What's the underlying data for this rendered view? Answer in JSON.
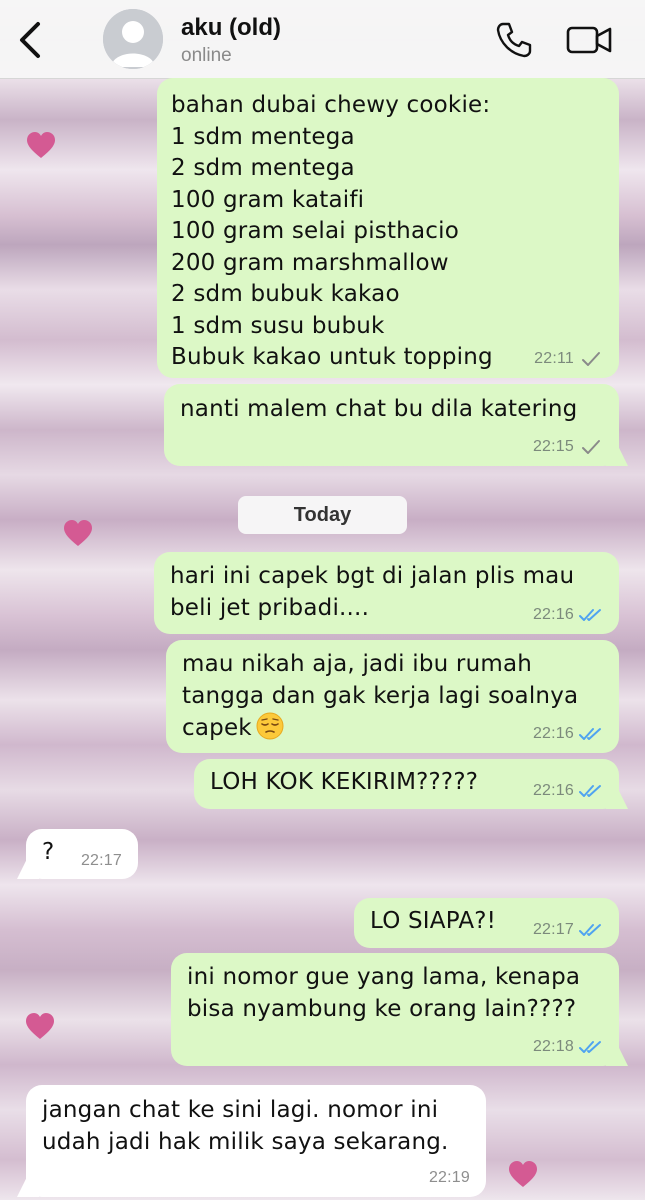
{
  "header": {
    "contact_name": "aku (old)",
    "status": "online"
  },
  "date_separator": "Today",
  "messages": [
    {
      "text": "bahan dubai chewy cookie:\n1 sdm mentega\n2 sdm mentega\n100 gram kataifi\n100 gram selai pisthacio\n200 gram marshmallow\n2 sdm bubuk kakao\n1 sdm susu bubuk\nBubuk kakao untuk topping",
      "time": "22:11",
      "status": "sent"
    },
    {
      "text": "nanti malem chat bu dila katering",
      "time": "22:15",
      "status": "sent"
    },
    {
      "text": "hari ini capek bgt di jalan plis mau\nbeli jet pribadi....",
      "time": "22:16",
      "status": "read"
    },
    {
      "text": "mau nikah aja, jadi ibu rumah\ntangga dan gak kerja lagi soalnya\ncapek",
      "time": "22:16",
      "status": "read",
      "emoji": "pensive-face"
    },
    {
      "text": "LOH KOK KEKIRIM?????",
      "time": "22:16",
      "status": "read"
    },
    {
      "text": "?",
      "time": "22:17",
      "direction": "incoming"
    },
    {
      "text": "LO SIAPA?!",
      "time": "22:17",
      "status": "read"
    },
    {
      "text": "ini nomor gue yang lama, kenapa\nbisa nyambung ke orang lain????",
      "time": "22:18",
      "status": "read"
    },
    {
      "text": "jangan chat ke sini lagi. nomor ini\nudah jadi hak milik saya sekarang.",
      "time": "22:19",
      "direction": "incoming"
    }
  ],
  "colors": {
    "outgoing_bubble": "#dcf8c6",
    "incoming_bubble": "#ffffff",
    "read_tick": "#4fa3f0",
    "sent_tick": "#8a8a8a",
    "heart": "#d45a93"
  }
}
